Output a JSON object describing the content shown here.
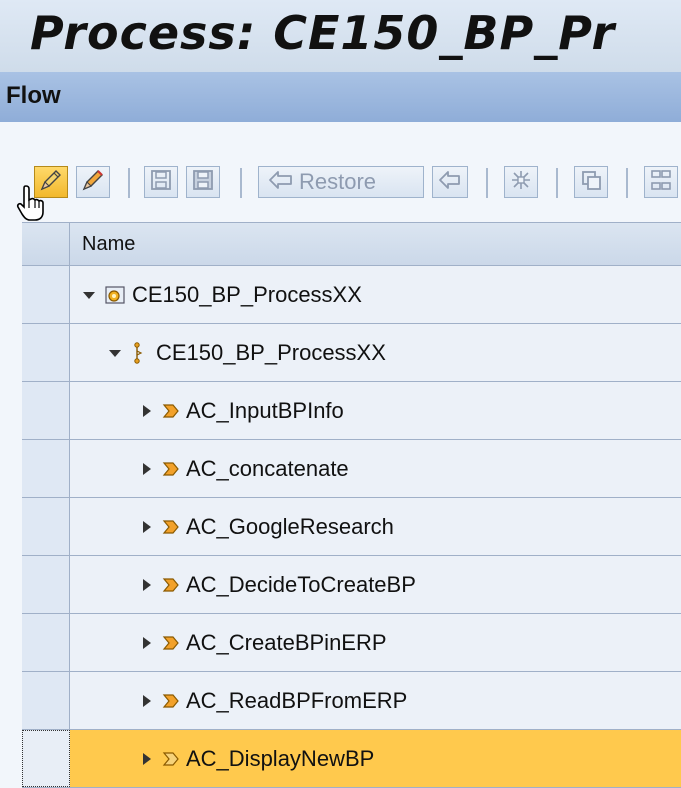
{
  "header": {
    "title": "Process: CE150_BP_Pr",
    "section": "Flow"
  },
  "toolbar": {
    "buttons": [
      {
        "name": "edit",
        "icon": "pencil-icon"
      },
      {
        "name": "edit-alt",
        "icon": "pencil-icon"
      },
      {
        "name": "save",
        "icon": "save-icon"
      },
      {
        "name": "save-as",
        "icon": "save-icon"
      },
      {
        "name": "restore",
        "icon": "restore-icon",
        "label": "Restore"
      },
      {
        "name": "restore-alt",
        "icon": "restore-icon"
      },
      {
        "name": "expand",
        "icon": "expand-icon"
      },
      {
        "name": "copy",
        "icon": "copy-icon"
      },
      {
        "name": "structure",
        "icon": "structure-icon"
      }
    ]
  },
  "tree": {
    "column_header": "Name",
    "rows": [
      {
        "label": "CE150_BP_ProcessXX",
        "level": 0,
        "expanded": true,
        "icon": "process-icon"
      },
      {
        "label": "CE150_BP_ProcessXX",
        "level": 1,
        "expanded": true,
        "icon": "flow-icon"
      },
      {
        "label": "AC_InputBPInfo",
        "level": 2,
        "expanded": false,
        "icon": "activity-icon"
      },
      {
        "label": "AC_concatenate",
        "level": 2,
        "expanded": false,
        "icon": "activity-icon"
      },
      {
        "label": "AC_GoogleResearch",
        "level": 2,
        "expanded": false,
        "icon": "activity-icon"
      },
      {
        "label": "AC_DecideToCreateBP",
        "level": 2,
        "expanded": false,
        "icon": "activity-icon"
      },
      {
        "label": "AC_CreateBPinERP",
        "level": 2,
        "expanded": false,
        "icon": "activity-icon"
      },
      {
        "label": "AC_ReadBPFromERP",
        "level": 2,
        "expanded": false,
        "icon": "activity-icon"
      },
      {
        "label": "AC_DisplayNewBP",
        "level": 2,
        "expanded": false,
        "icon": "activity-icon",
        "selected": true
      }
    ]
  },
  "colors": {
    "title_bg": "#cfdcea",
    "flow_bar": "#8fadd8",
    "selected_row": "#ffc94d",
    "pencil_active": "#f7c640"
  }
}
